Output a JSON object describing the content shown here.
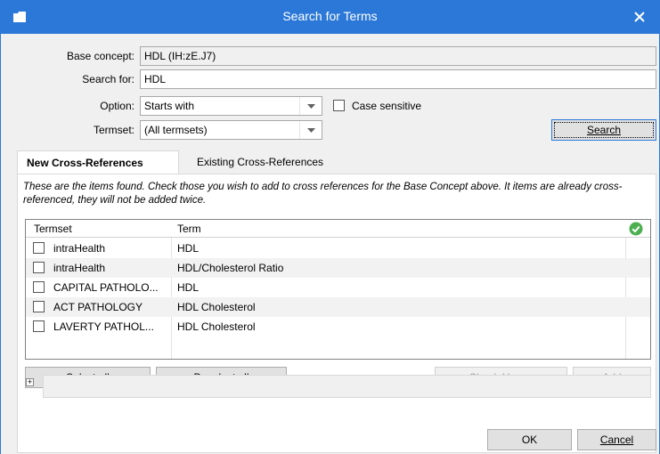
{
  "window": {
    "title": "Search for Terms",
    "app_icon": "folder-icon",
    "close_icon": "close-icon"
  },
  "form": {
    "base_concept_label": "Base concept:",
    "base_concept_value": "HDL (IH:zE.J7)",
    "search_for_label": "Search for:",
    "search_for_value": "HDL",
    "option_label": "Option:",
    "option_value": "Starts with",
    "case_sensitive_label": "Case sensitive",
    "case_sensitive_checked": false,
    "termset_label": "Termset:",
    "termset_value": "(All termsets)",
    "search_button": "Search"
  },
  "tabs": [
    {
      "label": "New Cross-References",
      "active": true
    },
    {
      "label": "Existing Cross-References",
      "active": false
    }
  ],
  "hint": "These are the items found. Check those you wish to add to cross references for the Base Concept above. It items are already cross-referenced, they will not be added twice.",
  "table": {
    "columns": [
      "Termset",
      "Term"
    ],
    "status_icon": "check-circle-icon",
    "status_color": "#4caf50",
    "rows": [
      {
        "termset": "intraHealth",
        "term": "HDL",
        "checked": false
      },
      {
        "termset": "intraHealth",
        "term": "HDL/Cholesterol Ratio",
        "checked": false
      },
      {
        "termset": "CAPITAL PATHOLO...",
        "term": "HDL",
        "checked": false
      },
      {
        "termset": "ACT PATHOLOGY",
        "term": "HDL Cholesterol",
        "checked": false
      },
      {
        "termset": "LAVERTY PATHOL...",
        "term": "HDL Cholesterol",
        "checked": false
      }
    ]
  },
  "actions": {
    "select_all": "Select all",
    "deselect_all": "Deselect all",
    "check_usage": "Check Usage",
    "add": "Add"
  },
  "expander_icon": "plus-box-icon",
  "footer": {
    "ok": "OK",
    "cancel": "Cancel"
  },
  "colors": {
    "titlebar": "#2b78d8",
    "accent": "#2b78d8"
  }
}
